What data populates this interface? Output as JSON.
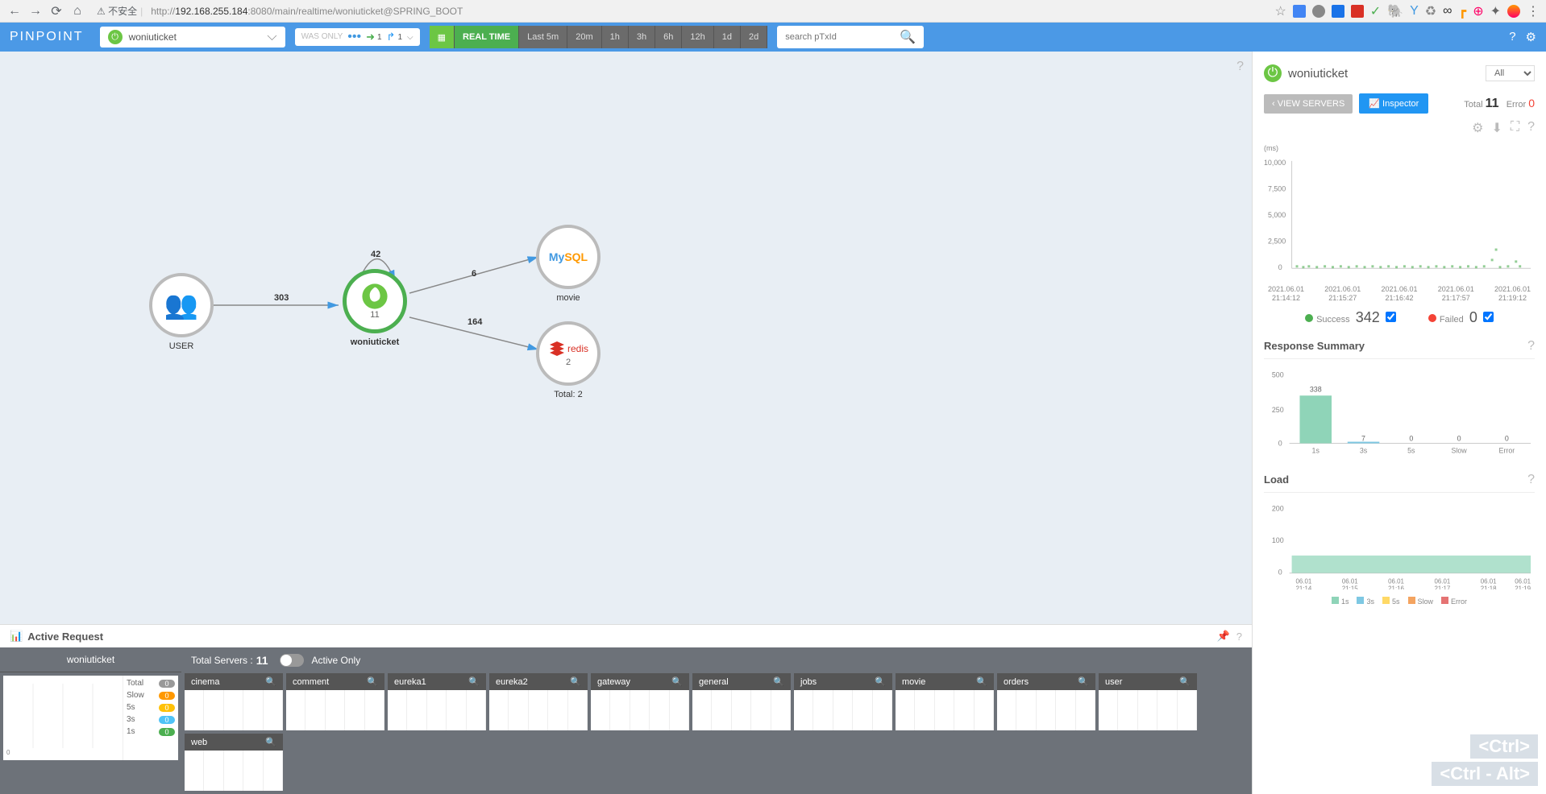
{
  "browser": {
    "security": "不安全",
    "url_prefix": "http://",
    "url_host": "192.168.255.184",
    "url_port": ":8080",
    "url_path": "/main/realtime/woniuticket@SPRING_BOOT"
  },
  "navbar": {
    "logo": "PINPOINT",
    "app_name": "woniuticket",
    "was_only": "WAS ONLY",
    "in_count": "1",
    "out_count": "1",
    "realtime": "REAL TIME",
    "time_buttons": [
      "Last 5m",
      "20m",
      "1h",
      "3h",
      "6h",
      "12h",
      "1d",
      "2d"
    ],
    "search_placeholder": "search pTxId"
  },
  "map": {
    "user": {
      "label": "USER"
    },
    "woniuticket": {
      "label": "woniuticket",
      "count": "11"
    },
    "mysql": {
      "label": "movie"
    },
    "redis": {
      "label": "Total: 2",
      "count": "2"
    },
    "edges": {
      "user_woniu": "303",
      "self": "42",
      "mysql": "6",
      "redis": "164"
    }
  },
  "right": {
    "title": "woniuticket",
    "filter": "All",
    "view_servers": "VIEW SERVERS",
    "inspector": "Inspector",
    "total_label": "Total",
    "total": "11",
    "error_label": "Error",
    "error": "0",
    "scatter": {
      "ylabel": "(ms)",
      "yticks": [
        "10,000",
        "7,500",
        "5,000",
        "2,500",
        "0"
      ],
      "xticks": [
        "2021.06.01\n21:14:12",
        "2021.06.01\n21:15:27",
        "2021.06.01\n21:16:42",
        "2021.06.01\n21:17:57",
        "2021.06.01\n21:19:12"
      ],
      "success_label": "Success",
      "success": "342",
      "failed_label": "Failed",
      "failed": "0"
    },
    "response_summary": {
      "title": "Response Summary"
    },
    "load": {
      "title": "Load",
      "legend": [
        "1s",
        "3s",
        "5s",
        "Slow",
        "Error"
      ],
      "xticks": [
        "06.01\n21:14",
        "06.01\n21:15",
        "06.01\n21:16",
        "06.01\n21:17",
        "06.01\n21:18",
        "06.01\n21:19"
      ]
    }
  },
  "chart_data": {
    "response_summary": {
      "type": "bar",
      "categories": [
        "1s",
        "3s",
        "5s",
        "Slow",
        "Error"
      ],
      "values": [
        338,
        7,
        0,
        0,
        0
      ],
      "ylim": [
        0,
        500
      ],
      "yticks": [
        0,
        250,
        500
      ]
    },
    "load": {
      "type": "bar",
      "yticks": [
        0,
        100,
        200
      ],
      "ylim": [
        0,
        200
      ]
    }
  },
  "active_request": {
    "title": "Active Request",
    "app": "woniuticket",
    "total_label": "Total",
    "total": "0",
    "slow_label": "Slow",
    "slow": "0",
    "s5_label": "5s",
    "s5": "0",
    "s3_label": "3s",
    "s3": "0",
    "s1_label": "1s",
    "s1": "0",
    "total_servers_label": "Total Servers :",
    "total_servers": "11",
    "active_only": "Active Only",
    "servers": [
      "cinema",
      "comment",
      "eureka1",
      "eureka2",
      "gateway",
      "general",
      "jobs",
      "movie",
      "orders",
      "user",
      "web"
    ]
  },
  "watermark": [
    "<Ctrl>",
    "<Ctrl - Alt>"
  ]
}
